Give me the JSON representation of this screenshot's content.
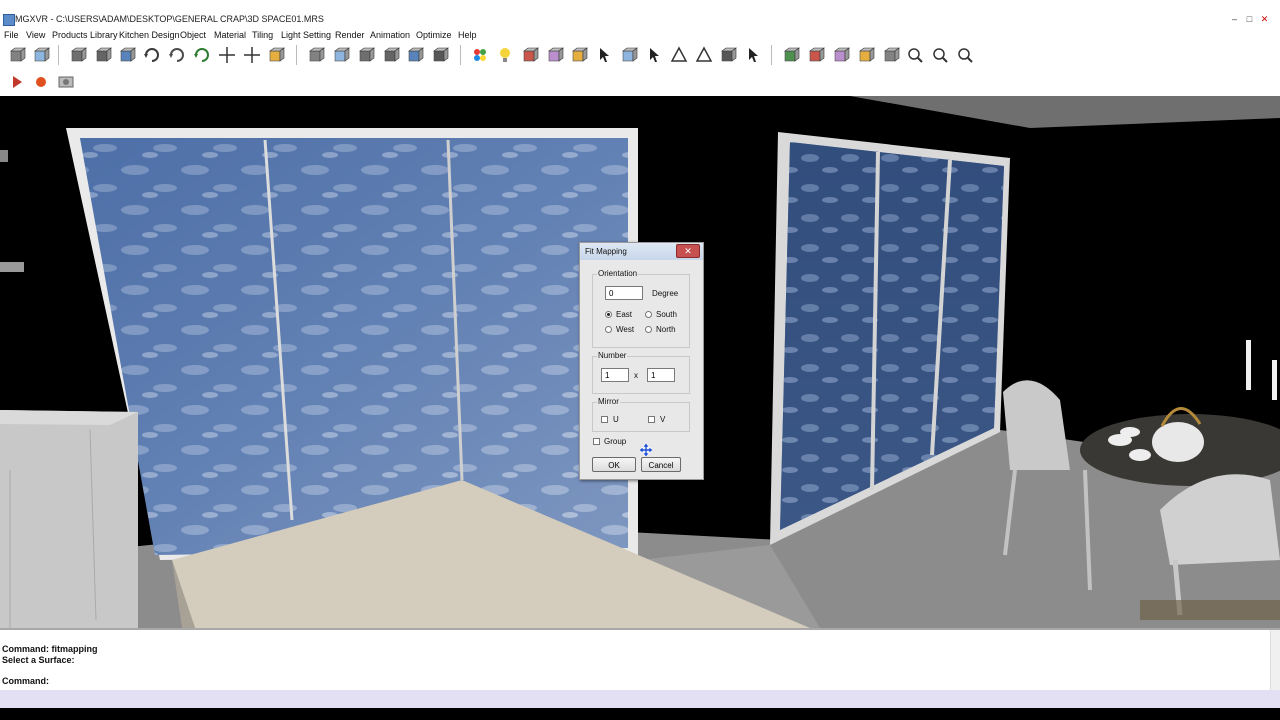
{
  "window": {
    "title": "MGXVR - C:\\USERS\\ADAM\\DESKTOP\\GENERAL CRAP\\3D SPACE01.MRS",
    "minimize": "–",
    "maximize": "□",
    "close": "✕"
  },
  "menu": [
    "File",
    "View",
    "Products Library",
    "Kitchen Design",
    "Object",
    "Material",
    "Tiling",
    "Light Setting",
    "Render",
    "Animation",
    "Optimize",
    "Help"
  ],
  "toolbar_icons": [
    "open-icon",
    "save-icon",
    "cube-icon",
    "box-icon",
    "wireframe-icon",
    "rotate-icon",
    "orbit-icon",
    "flip-icon",
    "move-icon",
    "pan-icon",
    "export-icon",
    "delete-object-icon",
    "tiling-icon",
    "erase-icon",
    "paint-icon",
    "apply-material-icon",
    "grid-icon",
    "color-palette-icon",
    "light-bulb-icon",
    "camera-icon",
    "door-icon",
    "copy-icon",
    "select-arrow-icon",
    "select-region-icon",
    "pointer-icon",
    "vertex-icon",
    "triangle-icon",
    "transform-icon",
    "cursor-plus-icon",
    "view-front-icon",
    "view-back-icon",
    "view-left-icon",
    "view-right-icon",
    "view-top-icon",
    "zoom-icon",
    "zoom-fit-icon",
    "zoom-extents-icon"
  ],
  "animation_toolbar": {
    "play": "play-icon",
    "record": "record-icon",
    "camera": "snapshot-icon"
  },
  "dialog": {
    "title": "Fit Mapping",
    "close": "✕",
    "orientation": {
      "label": "Orientation",
      "degree_value": "0",
      "degree_label": "Degree",
      "options": {
        "east": "East",
        "south": "South",
        "west": "West",
        "north": "North"
      },
      "selected": "East"
    },
    "number": {
      "label": "Number",
      "x_value": "1",
      "separator": "x",
      "y_value": "1"
    },
    "mirror": {
      "label": "Mirror",
      "u": "U",
      "v": "V"
    },
    "group_label": "Group",
    "ok": "OK",
    "cancel": "Cancel"
  },
  "command": {
    "line1": "Command: fitmapping",
    "line2": "Select a Surface:",
    "line3": "Command:"
  },
  "colors": {
    "sky_blue": "#5a7fb8",
    "floor": "#8a8a8a",
    "wall": "#000000",
    "status": "#e4e0f4"
  }
}
